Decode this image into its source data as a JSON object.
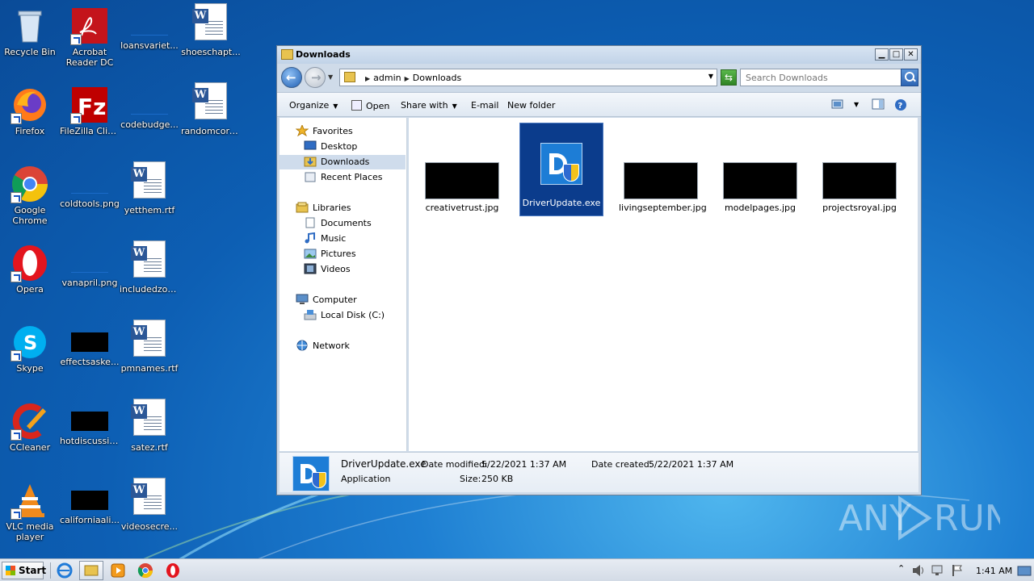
{
  "desktop": {
    "icons": [
      {
        "label": "Recycle Bin"
      },
      {
        "label": "Acrobat Reader DC"
      },
      {
        "label": "loansvariet..."
      },
      {
        "label": "shoeschapt..."
      },
      {
        "label": "Firefox"
      },
      {
        "label": "FileZilla Client"
      },
      {
        "label": "codebudge..."
      },
      {
        "label": "randomcore..."
      },
      {
        "label": "Google Chrome"
      },
      {
        "label": "coldtools.png"
      },
      {
        "label": "yetthem.rtf"
      },
      {
        "label": "Opera"
      },
      {
        "label": "vanapril.png"
      },
      {
        "label": "includedzon..."
      },
      {
        "label": "Skype"
      },
      {
        "label": "effectsaske..."
      },
      {
        "label": "pmnames.rtf"
      },
      {
        "label": "CCleaner"
      },
      {
        "label": "hotdiscussio..."
      },
      {
        "label": "satez.rtf"
      },
      {
        "label": "VLC media player"
      },
      {
        "label": "californiaali..."
      },
      {
        "label": "videosecre..."
      }
    ]
  },
  "window": {
    "title": "Downloads",
    "controls": {
      "minimize": "▁",
      "maximize": "□",
      "close": "✕"
    },
    "address": {
      "crumb1": "admin",
      "crumb2": "Downloads"
    },
    "search": {
      "placeholder": "Search Downloads"
    },
    "toolbar": {
      "organize": "Organize",
      "open": "Open",
      "share_with": "Share with",
      "email": "E-mail",
      "new_folder": "New folder"
    },
    "nav": {
      "favorites": "Favorites",
      "desktop": "Desktop",
      "downloads": "Downloads",
      "recent_places": "Recent Places",
      "libraries": "Libraries",
      "documents": "Documents",
      "music": "Music",
      "pictures": "Pictures",
      "videos": "Videos",
      "computer": "Computer",
      "local_disk": "Local Disk (C:)",
      "network": "Network"
    },
    "files": [
      {
        "name": "creativetrust.jpg",
        "selected": false
      },
      {
        "name": "DriverUpdate.exe",
        "selected": true
      },
      {
        "name": "livingseptember.jpg",
        "selected": false
      },
      {
        "name": "modelpages.jpg",
        "selected": false
      },
      {
        "name": "projectsroyal.jpg",
        "selected": false
      }
    ],
    "details": {
      "name": "DriverUpdate.exe",
      "type": "Application",
      "date_modified_label": "Date modified:",
      "date_modified": "5/22/2021 1:37 AM",
      "date_created_label": "Date created:",
      "date_created": "5/22/2021 1:37 AM",
      "size_label": "Size:",
      "size": "250 KB"
    }
  },
  "taskbar": {
    "start_label": "Start",
    "clock": "1:41 AM"
  },
  "watermark": {
    "text_left": "ANY",
    "text_right": "RUN"
  },
  "colors": {
    "selection": "#0b3c8c",
    "accent": "#1d7dd6"
  }
}
